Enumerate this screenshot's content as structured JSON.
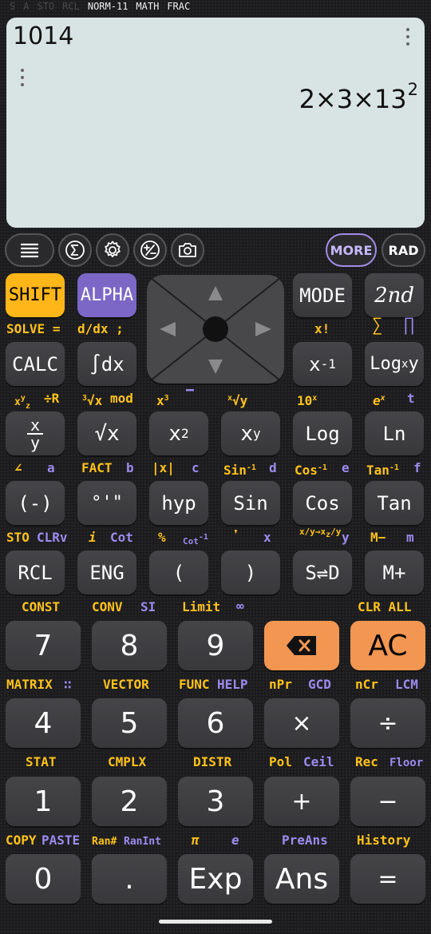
{
  "status": {
    "indicators_off": [
      "S",
      "A",
      "STO",
      "RCL"
    ],
    "indicators_on": [
      "NORM-11",
      "MATH",
      "FRAC"
    ]
  },
  "display": {
    "expression": "1014",
    "result_main": "2×3×13",
    "result_exp": "2"
  },
  "toolbar": {
    "menu_icon": "hamburger-icon",
    "sum_icon": "sigma-icon",
    "settings_icon": "gear-icon",
    "plusminus_icon": "plus-minus-icon",
    "camera_icon": "camera-icon",
    "more": "MORE",
    "angle_mode": "RAD"
  },
  "row1": {
    "shift": "SHIFT",
    "alpha": "ALPHA",
    "mode": "MODE",
    "second": "2nd"
  },
  "row1_labels": {
    "solve": "SOLVE",
    "solve_eq": "=",
    "ddx": "d/dx",
    "semicolon": ";",
    "xfact": "x!",
    "sigma": "∑",
    "pi_prod": "∏"
  },
  "row2": {
    "calc": "CALC",
    "integral": "∫dx",
    "x_inv_base": "x",
    "x_inv_exp": "-1",
    "logxy_base": "Log",
    "logxy_sub": "x",
    "logxy_end": "y"
  },
  "row2_labels": {
    "xyz_top": "x",
    "xyz_sup": "y",
    "xyz_sub": "z",
    "div_r": "÷R",
    "cbrt_idx": "3",
    "cbrt": "√x",
    "mod": "mod",
    "x3_base": "x",
    "x3_exp": "3",
    "overline": "▔",
    "xroot_idx": "x",
    "xroot": "√y",
    "ten_x_base": "10",
    "ten_x_exp": "x",
    "e_x_base": "e",
    "e_x_exp": "x",
    "t": "t"
  },
  "row3": {
    "frac_num": "x",
    "frac_den": "y",
    "sqrt": "√x",
    "x2_base": "x",
    "x2_exp": "2",
    "xy_base": "x",
    "xy_exp": "y",
    "log": "Log",
    "ln": "Ln"
  },
  "row3_labels": {
    "angle": "∠",
    "a": "a",
    "fact": "FACT",
    "b": "b",
    "abs": "|x|",
    "c": "c",
    "asin": "Sin",
    "asin_exp": "-1",
    "d": "d",
    "acos": "Cos",
    "acos_exp": "-1",
    "e": "e",
    "atan": "Tan",
    "atan_exp": "-1",
    "f": "f"
  },
  "row4": {
    "neg": "(-)",
    "dms": "°'\"",
    "hyp": "hyp",
    "sin": "Sin",
    "cos": "Cos",
    "tan": "Tan"
  },
  "row4_labels": {
    "sto": "STO",
    "clrv": "CLRv",
    "i": "i",
    "cot": "Cot",
    "percent": "%",
    "acot": "Cot",
    "acot_exp": "-1",
    "comma": "❜",
    "x": "x",
    "frac_conv_top1": "x",
    "frac_conv_bot1": "y",
    "frac_conv_arrow": "→x",
    "frac_conv_sub": "z",
    "frac_conv_top2": "y",
    "y": "y",
    "m_minus": "M−",
    "m": "m"
  },
  "row5": {
    "rcl": "RCL",
    "eng": "ENG",
    "lparen": "(",
    "rparen": ")",
    "sd": "S⇌D",
    "mplus": "M+"
  },
  "row5_labels": {
    "const": "CONST",
    "conv": "CONV",
    "si": "SI",
    "limit": "Limit",
    "inf": "∞",
    "clr_all": "CLR ALL"
  },
  "num_row1": {
    "seven": "7",
    "eight": "8",
    "nine": "9",
    "ac": "AC"
  },
  "num_row1_labels": {
    "matrix": "MATRIX",
    "matrix_icon": "∷",
    "vector": "VECTOR",
    "func": "FUNC",
    "help": "HELP",
    "npr": "nPr",
    "gcd": "GCD",
    "ncr": "nCr",
    "lcm": "LCM"
  },
  "num_row2": {
    "four": "4",
    "five": "5",
    "six": "6",
    "times": "×",
    "divide": "÷"
  },
  "num_row2_labels": {
    "stat": "STAT",
    "cmplx": "CMPLX",
    "distr": "DISTR",
    "pol": "Pol",
    "ceil": "Ceil",
    "rec": "Rec",
    "floor": "Floor"
  },
  "num_row3": {
    "one": "1",
    "two": "2",
    "three": "3",
    "plus": "+",
    "minus": "−"
  },
  "num_row3_labels": {
    "copy": "COPY",
    "paste": "PASTE",
    "ran": "Ran#",
    "ranint": "RanInt",
    "pi": "π",
    "e_const": "e",
    "preans": "PreAns",
    "history": "History"
  },
  "num_row4": {
    "zero": "0",
    "dot": ".",
    "exp": "Exp",
    "ans": "Ans",
    "equals": "="
  },
  "colors": {
    "shift": "#ffb619",
    "alpha": "#7c67c7",
    "orange_keys": "#f29652",
    "screen": "#d7e4e3",
    "label_yellow": "#ffc21a",
    "label_purple": "#9d8aef"
  }
}
